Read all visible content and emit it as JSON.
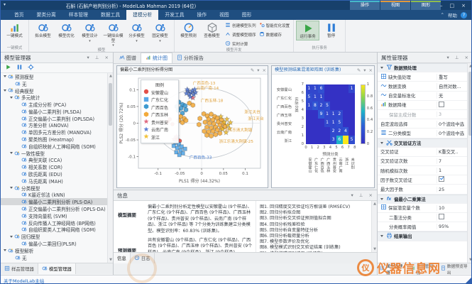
{
  "titlebar": {
    "title": "石斛 (石斛产地判别分析) - ModelLab Mahman 2019 (64位)",
    "context_groups": [
      {
        "label": "操作",
        "stripe": "#46b8c8"
      },
      {
        "label": "视图",
        "stripe": "#e09a3c"
      },
      {
        "label": "图形",
        "stripe": "#8fbc4e"
      }
    ],
    "min_label": "–",
    "max_label": "□",
    "close_label": "×"
  },
  "ribbon": {
    "tabs": [
      "首页",
      "聚类分离",
      "样本管理",
      "数据工具",
      "建模分析",
      "开发工具",
      "操作",
      "视图",
      "图形"
    ],
    "active_tab": "建模分析",
    "help_label": "帮助",
    "groups": [
      {
        "label": "一键模式",
        "items": [
          {
            "label": "一键模式",
            "icon": "chart-icon",
            "kind": "big"
          }
        ]
      },
      {
        "label": "模型",
        "items": [
          {
            "label": "拟合模型",
            "icon": "molecule-icon",
            "kind": "big"
          },
          {
            "label": "模型优化",
            "icon": "molecule-icon",
            "kind": "big"
          },
          {
            "label": "模型设计",
            "icon": "molecule-icon",
            "kind": "big",
            "dropdown": true
          },
          {
            "label": "一键拟合模型",
            "icon": "molecule-icon",
            "kind": "big",
            "dropdown": true
          },
          {
            "label": "分步模型",
            "icon": "molecule-icon",
            "kind": "big",
            "dropdown": true
          },
          {
            "label": "固定模型",
            "icon": "molecule-icon",
            "kind": "big",
            "dropdown": true
          }
        ]
      },
      {
        "label": "模型开发",
        "items": [
          {
            "label": "模型预测",
            "icon": "gauge-icon",
            "kind": "big"
          },
          {
            "label": "查看模型",
            "icon": "cube-icon",
            "kind": "big"
          },
          {
            "label": "创建模型队列",
            "icon": "list-icon",
            "kind": "small"
          },
          {
            "label": "调整模型顺序",
            "icon": "adjust-icon",
            "kind": "small"
          },
          {
            "label": "实时计算",
            "icon": "clock-icon",
            "kind": "small"
          },
          {
            "label": "智能优化设置",
            "icon": "magic-icon",
            "kind": "small2"
          },
          {
            "label": "数据缓存",
            "icon": "database-icon",
            "kind": "small2"
          }
        ]
      },
      {
        "label": "执行事务",
        "items": [
          {
            "label": "运行事务",
            "icon": "play-icon",
            "kind": "big",
            "highlight": true
          },
          {
            "label": "暂停",
            "icon": "pause-icon",
            "kind": "big"
          }
        ]
      }
    ]
  },
  "model_manager": {
    "title": "模型管理器",
    "toolbar": [
      "play-icon",
      "pause-icon",
      "gear-icon"
    ],
    "tree": [
      {
        "label": "预测模型",
        "level": 0,
        "folder": true
      },
      {
        "label": "无",
        "level": 1
      },
      {
        "label": "经典模型",
        "level": 0,
        "folder": true
      },
      {
        "label": "多元统计",
        "level": 1,
        "folder": true
      },
      {
        "label": "主成分分析 (PCA)",
        "level": 2
      },
      {
        "label": "偏最小二乘判别 (PLSDA)",
        "level": 2
      },
      {
        "label": "正交偏最小二乘判别 (OPLSDA)",
        "level": 2
      },
      {
        "label": "方差分析 (ANOVA)",
        "level": 2
      },
      {
        "label": "单因多元方差分析 (MANOVA)",
        "level": 2
      },
      {
        "label": "聚类热图 (Heatmap)",
        "level": 2
      },
      {
        "label": "自组织映射人工神经网络 (SOM)",
        "level": 2
      },
      {
        "label": "一致性模型",
        "level": 1,
        "folder": true
      },
      {
        "label": "典型关联 (CCA)",
        "level": 2
      },
      {
        "label": "相关系数 (COR)",
        "level": 2
      },
      {
        "label": "欧氏距离 (EDU)",
        "level": 2
      },
      {
        "label": "马氏距离 (MAH)",
        "level": 2
      },
      {
        "label": "分类模型",
        "level": 1,
        "folder": true
      },
      {
        "label": "K最近邻法 (kNN)",
        "level": 2
      },
      {
        "label": "偏最小二乘判别分析 (PLS-DA)",
        "level": 2,
        "selected": true
      },
      {
        "label": "正交偏最小二乘判别分析 (OPLS-DA)",
        "level": 2
      },
      {
        "label": "支持向量机 (SVM)",
        "level": 2
      },
      {
        "label": "反向传播人工神经网络 (BP网络)",
        "level": 2
      },
      {
        "label": "自组织聚类人工神经网络 (SOM)",
        "level": 2
      },
      {
        "label": "回归模型",
        "level": 1,
        "folder": true
      },
      {
        "label": "偏最小二乘回归(PLSR)",
        "level": 2
      },
      {
        "label": "模型解析",
        "level": 0,
        "folder": true
      },
      {
        "label": "无",
        "level": 1
      }
    ],
    "tabs": [
      "样品管理器",
      "模型管理器"
    ],
    "active_tab": "模型管理器"
  },
  "doc_tabs": {
    "tabs": [
      "图谱",
      "统计图",
      "分析报告"
    ],
    "active": "统计图"
  },
  "windows": [
    {
      "title": "偏最小二乘判别分析得分图"
    },
    {
      "title": "模型预测结果混淆矩阵图 (训练集)"
    }
  ],
  "info": {
    "title": "信息",
    "summary_label": "模型摘要",
    "summary_text": "偏最小二乘判别分析定性模型以安徽霍山 (9个样品)、广东仁化 (9个样品)、广西百色 (9个样品)、广西玉林 (9个样品)、贵州普安 (9个样品)、云南广南 (9个样品)、浙江 (9个样品) 等 7个分类为训练集建立分类模型。模型识别率：60.83% (训练集)。",
    "summary2_label": "预测摘要",
    "summary2_text": "共有安徽霍山 (9个样品)、广东仁化 (9个样品)、广西百色 (9个样品)、广西玉林 (9个样品)、贵州普安 (9个样品)、云南广南 (9个样品)、浙江 (9个样品)",
    "figures": [
      "图1. 回归精度交叉验证均方根误差 (RMSECV)",
      "图2. 回归分析拟合图",
      "图3. 回归分析交叉验证预测值拟合图",
      "图4. 回归分析残差检验",
      "图5. 回归分析自变量特征分析",
      "图6. 回归分析载荷量分析",
      "图7. 模型参数评价及优化",
      "图8. 模型模式识别交叉验证结果 (训练集)",
      "图9. 模型模式识别结果 (验证集)",
      "图10. 模型预测结果混淆矩阵图 (训练集)"
    ],
    "tabs": [
      "信息",
      "日志"
    ],
    "active_tab": "信息"
  },
  "property_manager": {
    "title": "属性管理器",
    "rows": [
      {
        "kind": "section",
        "icon": "filter-icon",
        "label": "数据预处理"
      },
      {
        "kind": "row",
        "icon": "grid-icon",
        "label": "缺失值处理",
        "value": "重写"
      },
      {
        "kind": "row",
        "icon": "wave-icon",
        "label": "数据变换",
        "value": "自然对数..."
      },
      {
        "kind": "row",
        "icon": "wave-icon",
        "label": "自变量标准化",
        "value": "无"
      },
      {
        "kind": "row",
        "icon": "chart-icon",
        "label": "数据降维",
        "checkbox": false
      },
      {
        "kind": "row",
        "sub": true,
        "label": "保留主成分数",
        "value": "3",
        "grayed": true
      },
      {
        "kind": "row",
        "label": "自定波段选择",
        "value": "0个波段中选"
      },
      {
        "kind": "row",
        "icon": "list-icon",
        "label": "二分类模型",
        "value": "0个波段中选"
      },
      {
        "kind": "section",
        "icon": "scissors-icon",
        "label": "交叉验证方法"
      },
      {
        "kind": "row",
        "label": "交叉验证",
        "value": "K重交叉.."
      },
      {
        "kind": "row",
        "label": "交叉验证次数",
        "value": "7"
      },
      {
        "kind": "row",
        "label": "随机模拟次数",
        "value": "1"
      },
      {
        "kind": "row",
        "label": "因子数交叉验证",
        "checkbox": true
      },
      {
        "kind": "row",
        "label": "最大因子数",
        "value": "25"
      },
      {
        "kind": "section",
        "icon": "fx-icon",
        "label": "偏最小二乘算法"
      },
      {
        "kind": "row",
        "icon": "grid-icon",
        "label": "保留潜变量个数",
        "value": "10"
      },
      {
        "kind": "row",
        "sub": true,
        "label": "二重法分类",
        "checkbox": false
      },
      {
        "kind": "row",
        "sub": true,
        "label": "分类概率阈值",
        "value": "95%"
      },
      {
        "kind": "section",
        "icon": "printer-icon",
        "label": "结果输出"
      }
    ],
    "tabs": [
      "属性管理器",
      "显示管理器",
      "数据预览导出"
    ],
    "active_tab": "属性管理器"
  },
  "statusbar": {
    "about_link": "关于ModelLab主站"
  },
  "watermark": {
    "text": "仪器信息网",
    "glyph": "仪"
  },
  "chart_data": [
    {
      "type": "scatter",
      "title": "偏最小二乘判别分析得分图",
      "xlabel": "PLS1 得分 (44.32%)",
      "ylabel": "PLS2 得分 (20.72%)",
      "xlim": [
        -0.145,
        0.135
      ],
      "ylim": [
        -0.135,
        0.135
      ],
      "xticks": [
        -0.1,
        -0.05,
        0,
        0.05,
        0.1
      ],
      "yticks": [
        -0.1,
        -0.05,
        0,
        0.05,
        0.1
      ],
      "legend_title": "图例",
      "ellipse": {
        "cx": 0.005,
        "cy": 0.0,
        "rx": 0.112,
        "ry": 0.105
      },
      "groups": [
        {
          "label": "安徽霍山",
          "marker": "circle",
          "color": "#e2504a",
          "points": [
            [
              -0.073,
              0.012
            ],
            [
              -0.067,
              -0.003
            ],
            [
              -0.078,
              0.004
            ],
            [
              -0.056,
              -0.047
            ],
            [
              -0.05,
              -0.053
            ]
          ]
        },
        {
          "label": "广东仁化",
          "marker": "square",
          "color": "#58a8e8",
          "points": [
            [
              -0.06,
              -0.058
            ],
            [
              -0.052,
              -0.063
            ],
            [
              -0.046,
              -0.07
            ],
            [
              -0.056,
              -0.074
            ],
            [
              -0.048,
              -0.082
            ],
            [
              -0.058,
              -0.087
            ],
            [
              -0.043,
              -0.09
            ],
            [
              -0.051,
              -0.095
            ],
            [
              -0.038,
              -0.077
            ],
            [
              -0.064,
              -0.068
            ]
          ]
        },
        {
          "label": "广西百色",
          "marker": "hexagon",
          "color": "#3e9ad0",
          "points": [
            [
              -0.052,
              0.063
            ],
            [
              -0.044,
              0.056
            ],
            [
              -0.057,
              0.05
            ],
            [
              -0.047,
              0.045
            ],
            [
              -0.038,
              0.052
            ],
            [
              -0.054,
              0.038
            ],
            [
              -0.044,
              0.03
            ],
            [
              -0.036,
              0.04
            ]
          ]
        },
        {
          "label": "广西玉林",
          "marker": "hexagon",
          "color": "#f2aa3a",
          "points": [
            [
              0.005,
              0.028
            ],
            [
              0.013,
              0.022
            ],
            [
              0.022,
              0.027
            ],
            [
              0.03,
              0.02
            ],
            [
              0.016,
              0.012
            ],
            [
              0.026,
              0.01
            ],
            [
              0.036,
              0.015
            ],
            [
              0.008,
              0.003
            ],
            [
              0.018,
              0.0
            ],
            [
              0.028,
              -0.002
            ],
            [
              0.038,
              0.004
            ],
            [
              0.046,
              0.01
            ],
            [
              0.012,
              -0.012
            ],
            [
              0.022,
              -0.014
            ],
            [
              0.032,
              -0.012
            ],
            [
              0.042,
              -0.006
            ],
            [
              0.05,
              -0.001
            ],
            [
              0.006,
              -0.024
            ],
            [
              0.016,
              -0.026
            ],
            [
              0.026,
              -0.024
            ],
            [
              0.036,
              -0.02
            ],
            [
              0.046,
              -0.016
            ],
            [
              0.054,
              -0.01
            ],
            [
              0.012,
              -0.036
            ],
            [
              0.022,
              -0.038
            ],
            [
              0.032,
              -0.034
            ],
            [
              0.042,
              -0.03
            ],
            [
              -0.004,
              0.014
            ],
            [
              -0.006,
              -0.004
            ],
            [
              -0.048,
              0.02
            ],
            [
              -0.04,
              0.014
            ],
            [
              -0.052,
              0.008
            ],
            [
              -0.044,
              0.002
            ],
            [
              -0.036,
              0.008
            ],
            [
              -0.028,
              0.06
            ],
            [
              -0.02,
              0.054
            ]
          ]
        },
        {
          "label": "贵州普安",
          "marker": "star",
          "color": "#e06a80",
          "points": [
            [
              -0.063,
              -0.048
            ],
            [
              -0.02,
              0.076
            ],
            [
              -0.058,
              -0.04
            ]
          ]
        },
        {
          "label": "云南广南",
          "marker": "star",
          "color": "#5b7fd6",
          "points": [
            [
              -0.031,
              0.096
            ],
            [
              -0.024,
              0.091
            ],
            [
              -0.018,
              0.086
            ],
            [
              -0.028,
              0.086
            ],
            [
              -0.035,
              0.089
            ],
            [
              -0.021,
              0.097
            ],
            [
              -0.014,
              0.092
            ],
            [
              -0.026,
              0.079
            ],
            [
              -0.033,
              0.101
            ],
            [
              -0.016,
              0.101
            ]
          ]
        },
        {
          "label": "浙江",
          "marker": "star",
          "color": "#f2c23a",
          "points": [
            [
              0.052,
              0.003
            ],
            [
              0.06,
              -0.006
            ],
            [
              0.048,
              -0.018
            ],
            [
              0.058,
              0.012
            ],
            [
              0.066,
              0.002
            ],
            [
              0.056,
              -0.028
            ],
            [
              0.064,
              -0.016
            ],
            [
              0.044,
              0.02
            ]
          ]
        }
      ],
      "annotations": [
        {
          "text": "广西百色-13",
          "x": -0.02,
          "y": 0.116,
          "color": "#dfa13c"
        },
        {
          "text": "云南广南-14",
          "x": -0.012,
          "y": 0.101,
          "color": "#dfa13c"
        },
        {
          "text": "广西玉林-18",
          "x": -0.002,
          "y": 0.064,
          "color": "#dfa13c"
        },
        {
          "text": "浙江天台",
          "x": 0.098,
          "y": 0.03,
          "color": "#dfa13c"
        },
        {
          "text": "浙江天台",
          "x": 0.106,
          "y": 0.01,
          "color": "#dfa13c"
        },
        {
          "text": "浙江乐清大荆镇",
          "x": 0.052,
          "y": -0.024,
          "color": "#dfa13c"
        },
        {
          "text": "浙江乐清大荆镇-25",
          "x": 0.04,
          "y": -0.058,
          "color": "#dfa13c"
        },
        {
          "text": "广西百色-33",
          "x": -0.028,
          "y": -0.106,
          "color": "#4a7fd0"
        }
      ]
    },
    {
      "type": "heatmap",
      "title": "模型预测结果混淆矩阵图 (训练集)",
      "xlabel": "预测分类",
      "ylabel": "实际分类",
      "row_labels": [
        "安徽霍山",
        "广东仁化",
        "广西百色",
        "广西玉林",
        "贵州普安",
        "云南广南",
        "浙江"
      ],
      "col_labels": [
        "安徽霍山",
        "广东仁化",
        "广西百色",
        "广西玉林",
        "贵州普安",
        "云南广南",
        "浙江",
        "未识别"
      ],
      "xticks": [
        0,
        1,
        2,
        3,
        4,
        5,
        6,
        7,
        8
      ],
      "yticks": [
        7,
        6,
        5,
        4,
        3,
        2,
        1,
        0
      ],
      "values": [
        [
          1,
          1,
          6,
          0,
          0,
          0,
          0,
          1
        ],
        [
          5,
          1,
          1,
          0,
          0,
          0,
          0,
          0
        ],
        [
          1,
          8,
          2,
          5,
          0,
          0,
          0,
          0
        ],
        [
          0,
          0,
          9,
          1,
          1,
          2,
          0,
          0
        ],
        [
          0,
          0,
          0,
          1,
          1,
          5,
          0,
          0
        ],
        [
          0,
          0,
          0,
          0,
          2,
          2,
          4,
          0
        ],
        [
          0,
          0,
          0,
          0,
          3,
          6,
          0,
          5
        ]
      ],
      "frac": [
        [
          0.12,
          0.12,
          0.17,
          0,
          0,
          0,
          0,
          0.12
        ],
        [
          0.15,
          0.12,
          0.12,
          0,
          0,
          0,
          0,
          0
        ],
        [
          0.12,
          0.2,
          0.13,
          0.16,
          0,
          0,
          0,
          0
        ],
        [
          0,
          0,
          0.22,
          0.12,
          0.12,
          0.13,
          0,
          0
        ],
        [
          0,
          0,
          0,
          0.12,
          0.12,
          0.16,
          0,
          0
        ],
        [
          0,
          0,
          0,
          0,
          0.13,
          0.13,
          0.18,
          0
        ],
        [
          0,
          0,
          0,
          0,
          0.14,
          0.55,
          1.0,
          0.15
        ]
      ],
      "colorbar": {
        "min": 0,
        "max": 1,
        "ticks": [
          "1",
          "0.8",
          "0.6",
          "0.4",
          "0.2",
          "0"
        ]
      }
    }
  ]
}
